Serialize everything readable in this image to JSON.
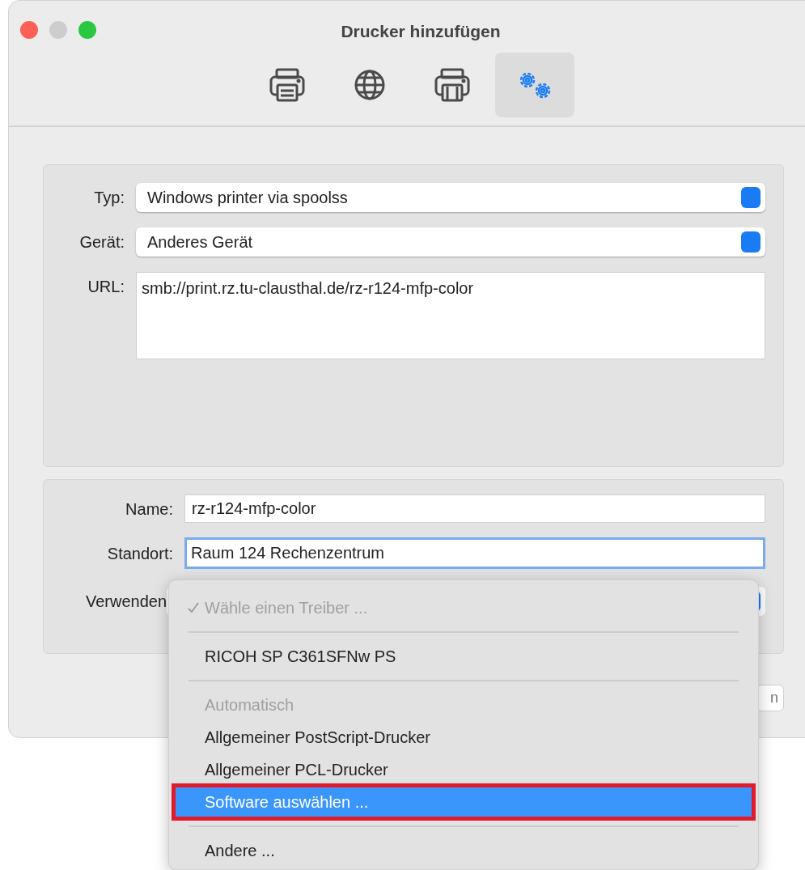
{
  "window": {
    "title": "Drucker hinzufügen"
  },
  "toolbar": [
    {
      "kind": "printer",
      "selected": false
    },
    {
      "kind": "globe",
      "selected": false
    },
    {
      "kind": "printer-tray",
      "selected": false
    },
    {
      "kind": "gears",
      "selected": true
    }
  ],
  "connection": {
    "type": {
      "label": "Typ:",
      "value": "Windows printer via spoolss"
    },
    "device": {
      "label": "Gerät:",
      "value": "Anderes Gerät"
    },
    "url": {
      "label": "URL:",
      "value": "smb://print.rz.tu-clausthal.de/rz-r124-mfp-color"
    }
  },
  "details": {
    "name": {
      "label": "Name:",
      "value": "rz-r124-mfp-color",
      "focused": false
    },
    "location": {
      "label": "Standort:",
      "value": "Raum 124 Rechenzentrum",
      "focused": true
    },
    "driver": {
      "label": "Verwenden"
    }
  },
  "partial_button": {
    "label": "n"
  },
  "driver_menu": [
    {
      "kind": "item",
      "label": "Wähle einen Treiber ...",
      "checked": true,
      "disabled": true,
      "selected": false,
      "annotated": false
    },
    {
      "kind": "separator"
    },
    {
      "kind": "item",
      "label": "RICOH SP C361SFNw PS",
      "checked": false,
      "disabled": false,
      "selected": false,
      "annotated": false
    },
    {
      "kind": "separator"
    },
    {
      "kind": "header",
      "label": "Automatisch"
    },
    {
      "kind": "item",
      "label": "Allgemeiner PostScript-Drucker",
      "checked": false,
      "disabled": false,
      "selected": false,
      "annotated": false
    },
    {
      "kind": "item",
      "label": "Allgemeiner PCL-Drucker",
      "checked": false,
      "disabled": false,
      "selected": false,
      "annotated": false
    },
    {
      "kind": "item",
      "label": "Software auswählen ...",
      "checked": false,
      "disabled": false,
      "selected": true,
      "annotated": true
    },
    {
      "kind": "separator"
    },
    {
      "kind": "item",
      "label": "Andere ...",
      "checked": false,
      "disabled": false,
      "selected": false,
      "annotated": false
    }
  ]
}
